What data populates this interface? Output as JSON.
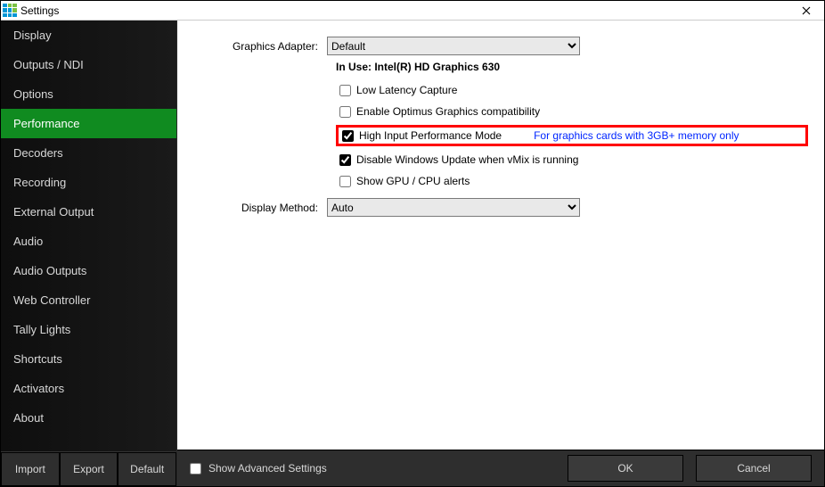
{
  "window": {
    "title": "Settings"
  },
  "sidebar": {
    "items": [
      {
        "label": "Display"
      },
      {
        "label": "Outputs / NDI"
      },
      {
        "label": "Options"
      },
      {
        "label": "Performance",
        "active": true
      },
      {
        "label": "Decoders"
      },
      {
        "label": "Recording"
      },
      {
        "label": "External Output"
      },
      {
        "label": "Audio"
      },
      {
        "label": "Audio Outputs"
      },
      {
        "label": "Web Controller"
      },
      {
        "label": "Tally Lights"
      },
      {
        "label": "Shortcuts"
      },
      {
        "label": "Activators"
      },
      {
        "label": "About"
      }
    ],
    "buttons": {
      "import": "Import",
      "export": "Export",
      "default": "Default"
    }
  },
  "form": {
    "graphics_adapter": {
      "label": "Graphics Adapter:",
      "value": "Default"
    },
    "in_use": {
      "prefix": "In Use: ",
      "value": "Intel(R) HD Graphics 630"
    },
    "checks": {
      "low_latency": {
        "label": "Low Latency Capture",
        "checked": false
      },
      "optimus": {
        "label": "Enable Optimus Graphics compatibility",
        "checked": false
      },
      "high_input": {
        "label": "High Input Performance Mode",
        "checked": true,
        "hint": "For graphics cards with 3GB+ memory only"
      },
      "disable_update": {
        "label": "Disable Windows Update when vMix is running",
        "checked": true
      },
      "show_alerts": {
        "label": "Show GPU / CPU alerts",
        "checked": false
      }
    },
    "display_method": {
      "label": "Display Method:",
      "value": "Auto"
    }
  },
  "bottom": {
    "advanced_label": "Show Advanced Settings",
    "advanced_checked": false,
    "ok": "OK",
    "cancel": "Cancel"
  }
}
